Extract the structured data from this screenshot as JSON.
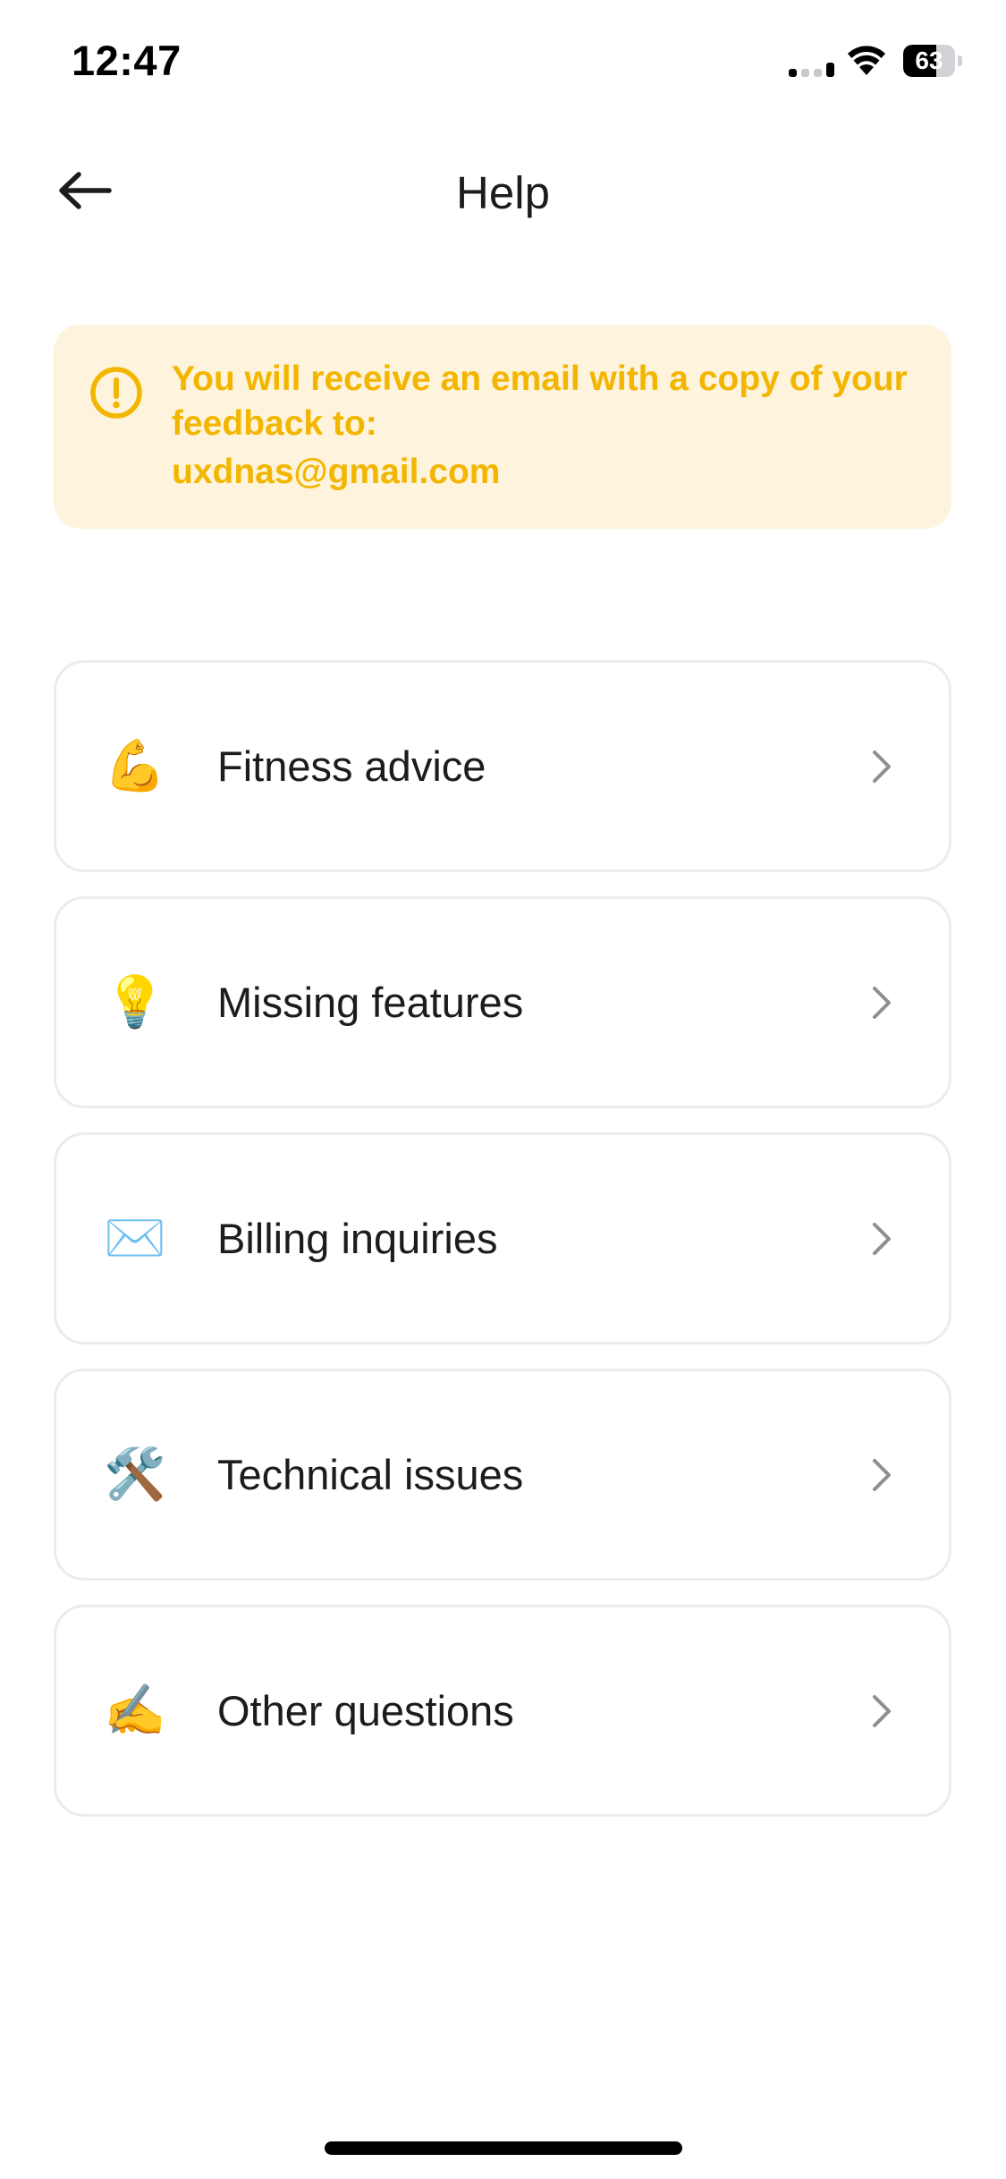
{
  "status_bar": {
    "time": "12:47",
    "battery_level": "63",
    "signal_bars_active": 1,
    "signal_bars_total": 4
  },
  "nav": {
    "title": "Help",
    "back_icon": "arrow-left-icon"
  },
  "notice": {
    "icon": "alert-circle-icon",
    "message": "You will receive an email with a copy of your feedback to:",
    "email": "uxdnas@gmail.com",
    "text_color": "#f3b600",
    "background_color": "#fef3dc"
  },
  "help_items": [
    {
      "emoji": "💪",
      "icon": "flexed-biceps-icon",
      "label": "Fitness advice"
    },
    {
      "emoji": "💡",
      "icon": "light-bulb-icon",
      "label": "Missing features"
    },
    {
      "emoji": "✉️",
      "icon": "envelope-icon",
      "label": "Billing inquiries"
    },
    {
      "emoji": "🛠️",
      "icon": "hammer-and-wrench-icon",
      "label": "Technical issues"
    },
    {
      "emoji": "✍️",
      "icon": "writing-hand-icon",
      "label": "Other questions"
    }
  ],
  "colors": {
    "card_border": "#ececee",
    "chevron": "#8e8e93",
    "text_primary": "#1c1c1e"
  }
}
